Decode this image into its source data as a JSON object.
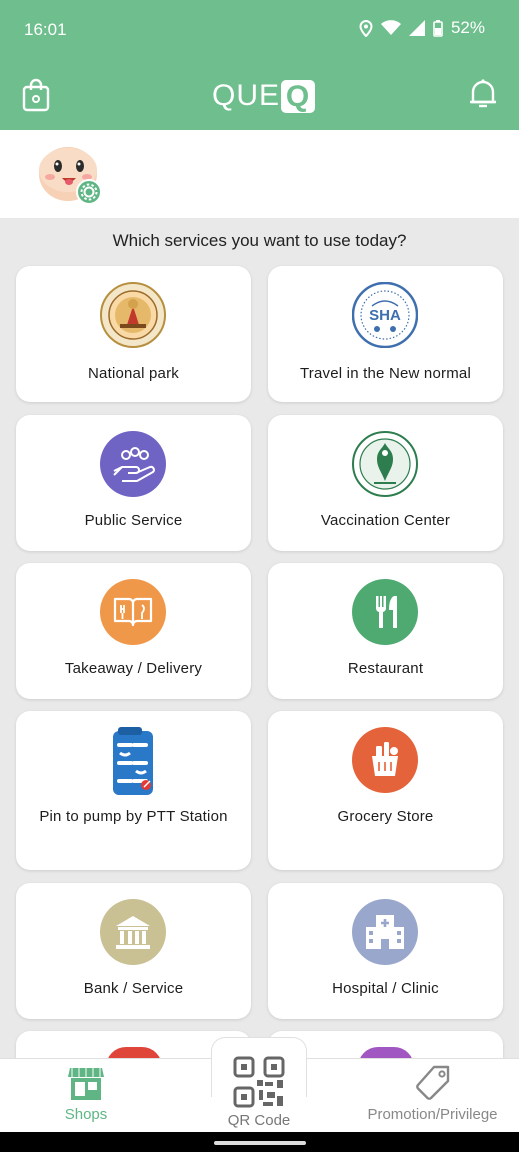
{
  "status_bar": {
    "time": "16:01",
    "battery": "52%"
  },
  "app_bar": {
    "logo_text": "QUE",
    "logo_box": "Q"
  },
  "main": {
    "prompt": "Which services you want to use today?"
  },
  "services": [
    {
      "label": "National park",
      "icon": "national-park-seal-icon"
    },
    {
      "label": "Travel in the New normal",
      "icon": "sha-seal-icon"
    },
    {
      "label": "Public Service",
      "icon": "hands-people-icon",
      "color": "#6f64c3"
    },
    {
      "label": "Vaccination Center",
      "icon": "bangkok-seal-icon"
    },
    {
      "label": "Takeaway / Delivery",
      "icon": "menu-book-icon",
      "color": "#f0984a"
    },
    {
      "label": "Restaurant",
      "icon": "fork-knife-icon",
      "color": "#4faa72"
    },
    {
      "label": "Pin to pump by PTT Station",
      "icon": "ptt-pin-to-pump-icon"
    },
    {
      "label": "Grocery Store",
      "icon": "grocery-bag-icon",
      "color": "#e4633a"
    },
    {
      "label": "Bank / Service",
      "icon": "bank-icon",
      "color": "#c9c194"
    },
    {
      "label": "Hospital / Clinic",
      "icon": "hospital-icon",
      "color": "#99a7cc"
    }
  ],
  "bottom_nav": {
    "shops": "Shops",
    "qr": "QR Code",
    "promo": "Promotion/Privilege"
  },
  "colors": {
    "brand": "#6ebf8d",
    "active_tab": "#5fb684"
  }
}
